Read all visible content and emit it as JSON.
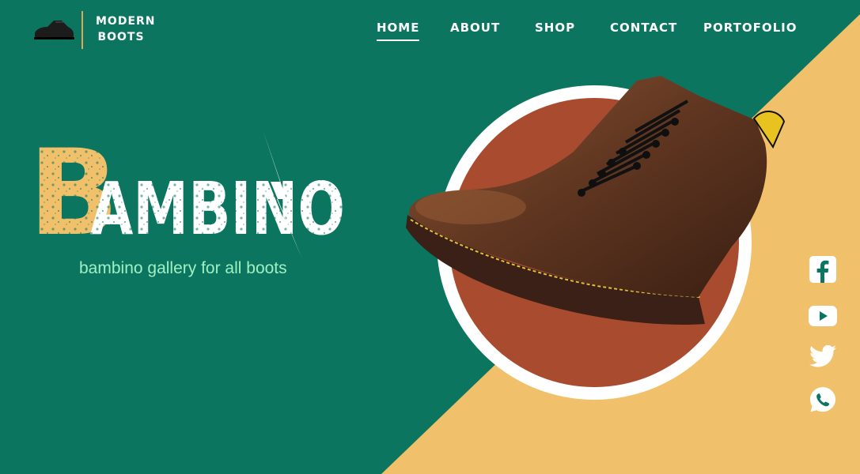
{
  "brand": {
    "line1": "MODERN",
    "line2": "BOOTS"
  },
  "nav": [
    {
      "label": "HOME",
      "active": true
    },
    {
      "label": "ABOUT",
      "active": false
    },
    {
      "label": "SHOP",
      "active": false
    },
    {
      "label": "CONTACT",
      "active": false
    },
    {
      "label": "PORTOFOLIO",
      "active": false
    }
  ],
  "hero": {
    "title_first": "B",
    "title_rest": "AMBINO",
    "tagline": "bambino gallery for all boots"
  },
  "social": [
    {
      "icon": "facebook-icon"
    },
    {
      "icon": "youtube-icon"
    },
    {
      "icon": "twitter-icon"
    },
    {
      "icon": "whatsapp-icon"
    }
  ],
  "colors": {
    "background": "#0b7560",
    "accent": "#f1c06a",
    "circle": "#a94b2f",
    "tagline": "#9ff0c2"
  }
}
